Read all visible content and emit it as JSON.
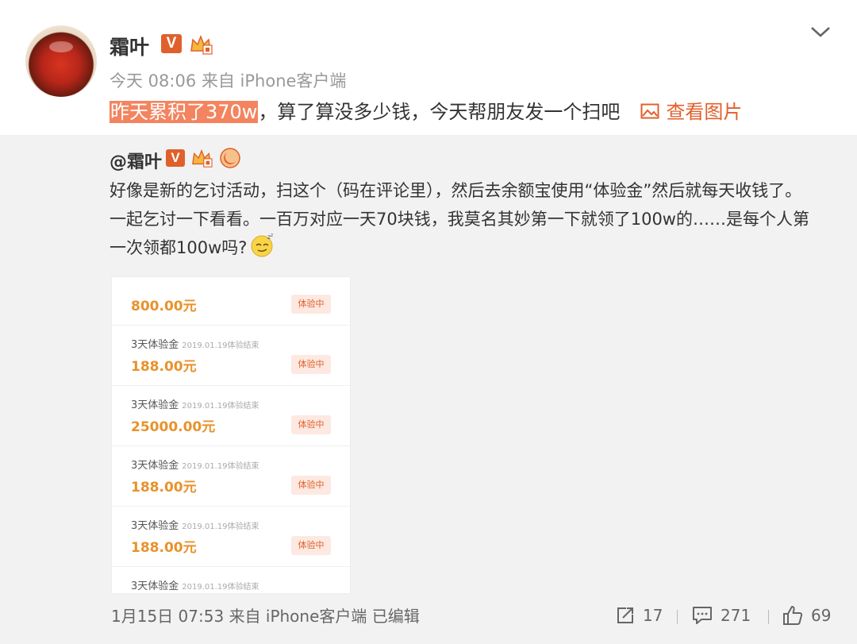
{
  "post": {
    "username": "霜叶",
    "badge_v": "V",
    "meta": "今天 08:06 来自 iPhone客户端",
    "text_highlight": "昨天累积了370w",
    "text_rest": "，算了算没多少钱，今天帮朋友发一个扫吧",
    "view_pic": "查看图片"
  },
  "repost": {
    "user": "@霜叶",
    "badge_v": "V",
    "lines": [
      "好像是新的乞讨活动，扫这个（码在评论里），然后去余额宝使用“体验金”然后就每天收钱了。",
      "一起乞讨一下看看。一百万对应一天70块钱，我莫名其妙第一下就领了100w的……是每个人第",
      "一次领都100w吗?"
    ],
    "entries": [
      {
        "title": "",
        "date": "",
        "amount": "800.00元",
        "tag": "体验中"
      },
      {
        "title": "3天体验金",
        "date": "2019.01.19体验结束",
        "amount": "188.00元",
        "tag": "体验中"
      },
      {
        "title": "3天体验金",
        "date": "2019.01.19体验结束",
        "amount": "25000.00元",
        "tag": "体验中"
      },
      {
        "title": "3天体验金",
        "date": "2019.01.19体验结束",
        "amount": "188.00元",
        "tag": "体验中"
      },
      {
        "title": "3天体验金",
        "date": "2019.01.19体验结束",
        "amount": "188.00元",
        "tag": "体验中"
      },
      {
        "title": "3天体验金",
        "date": "2019.01.19体验结束",
        "amount": "",
        "tag": ""
      }
    ],
    "footer_meta": "1月15日 07:53 来自 iPhone客户端   已编辑",
    "repost_count": "17",
    "comment_count": "271",
    "like_count": "69"
  },
  "colors": {
    "accent": "#e0602c",
    "highlight": "#f3845f",
    "amount": "#e8922b",
    "repost_bg": "#f2f2f2"
  }
}
